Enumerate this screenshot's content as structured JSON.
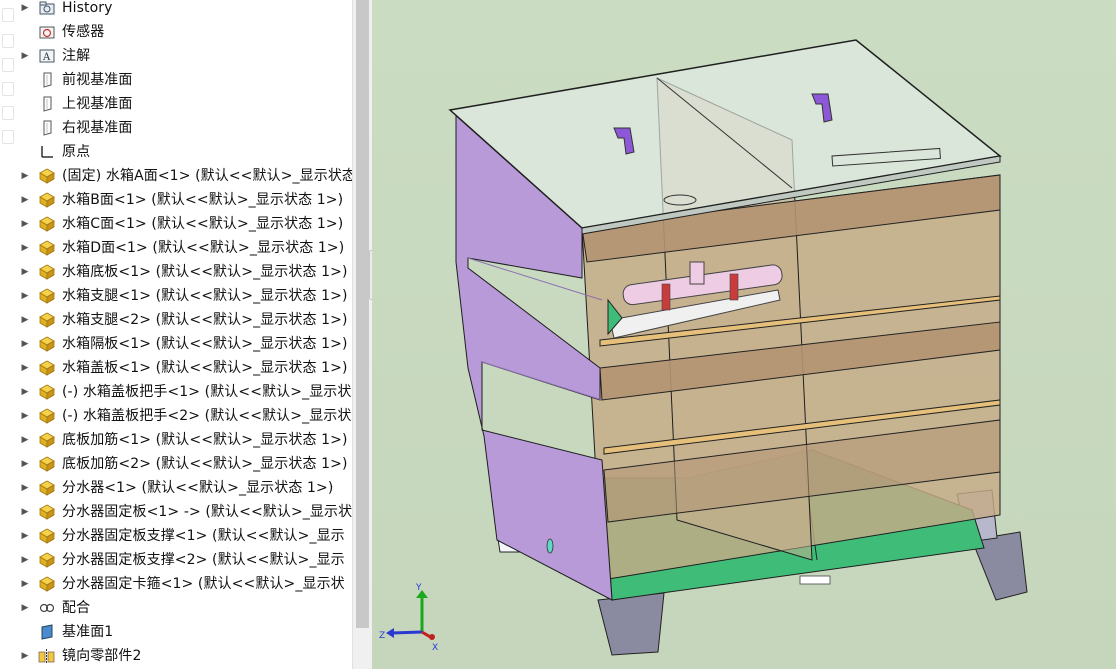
{
  "feature_tree": [
    {
      "label": "History",
      "icon": "history-icon",
      "expandable": true
    },
    {
      "label": "传感器",
      "icon": "sensor-icon",
      "expandable": false
    },
    {
      "label": "注解",
      "icon": "annotation-icon",
      "expandable": true
    },
    {
      "label": "前视基准面",
      "icon": "plane-icon",
      "expandable": false
    },
    {
      "label": "上视基准面",
      "icon": "plane-icon",
      "expandable": false
    },
    {
      "label": "右视基准面",
      "icon": "plane-icon",
      "expandable": false
    },
    {
      "label": "原点",
      "icon": "origin-icon",
      "expandable": false
    },
    {
      "label": "(固定) 水箱A面<1> (默认<<默认>_显示状态",
      "icon": "part-icon",
      "expandable": true
    },
    {
      "label": "水箱B面<1> (默认<<默认>_显示状态 1>)",
      "icon": "part-icon",
      "expandable": true
    },
    {
      "label": "水箱C面<1> (默认<<默认>_显示状态 1>)",
      "icon": "part-icon",
      "expandable": true
    },
    {
      "label": "水箱D面<1> (默认<<默认>_显示状态 1>)",
      "icon": "part-icon",
      "expandable": true
    },
    {
      "label": "水箱底板<1> (默认<<默认>_显示状态 1>)",
      "icon": "part-icon",
      "expandable": true
    },
    {
      "label": "水箱支腿<1> (默认<<默认>_显示状态 1>)",
      "icon": "part-icon",
      "expandable": true
    },
    {
      "label": "水箱支腿<2> (默认<<默认>_显示状态 1>)",
      "icon": "part-icon",
      "expandable": true
    },
    {
      "label": "水箱隔板<1> (默认<<默认>_显示状态 1>)",
      "icon": "part-icon",
      "expandable": true
    },
    {
      "label": "水箱盖板<1> (默认<<默认>_显示状态 1>)",
      "icon": "part-icon",
      "expandable": true
    },
    {
      "label": "(-) 水箱盖板把手<1> (默认<<默认>_显示状",
      "icon": "part-icon",
      "expandable": true
    },
    {
      "label": "(-) 水箱盖板把手<2> (默认<<默认>_显示状",
      "icon": "part-icon",
      "expandable": true
    },
    {
      "label": "底板加筋<1> (默认<<默认>_显示状态 1>)",
      "icon": "part-icon",
      "expandable": true
    },
    {
      "label": "底板加筋<2> (默认<<默认>_显示状态 1>)",
      "icon": "part-icon",
      "expandable": true
    },
    {
      "label": "分水器<1> (默认<<默认>_显示状态 1>)",
      "icon": "part-icon",
      "expandable": true
    },
    {
      "label": "分水器固定板<1> -> (默认<<默认>_显示状",
      "icon": "part-icon",
      "expandable": true
    },
    {
      "label": "分水器固定板支撑<1> (默认<<默认>_显示",
      "icon": "part-icon",
      "expandable": true
    },
    {
      "label": "分水器固定板支撑<2> (默认<<默认>_显示",
      "icon": "part-icon",
      "expandable": true
    },
    {
      "label": "分水器固定卡箍<1> (默认<<默认>_显示状",
      "icon": "part-icon",
      "expandable": true
    },
    {
      "label": "配合",
      "icon": "mates-icon",
      "expandable": true
    },
    {
      "label": "基准面1",
      "icon": "reference-plane-icon",
      "expandable": false
    },
    {
      "label": "镜向零部件2",
      "icon": "mirror-component-icon",
      "expandable": true
    }
  ],
  "triad": {
    "x_label": "X",
    "y_label": "Y",
    "z_label": "Z"
  },
  "colors": {
    "viewport_bg": "#c9d9c0",
    "tank_purple": "#b89ad8",
    "tank_tan": "#c6ab86",
    "floor_green": "#3fbd78",
    "leg_gray": "#8a8aa0",
    "handle_purple": "#8c58d8",
    "strap_red": "#c83c3c"
  }
}
